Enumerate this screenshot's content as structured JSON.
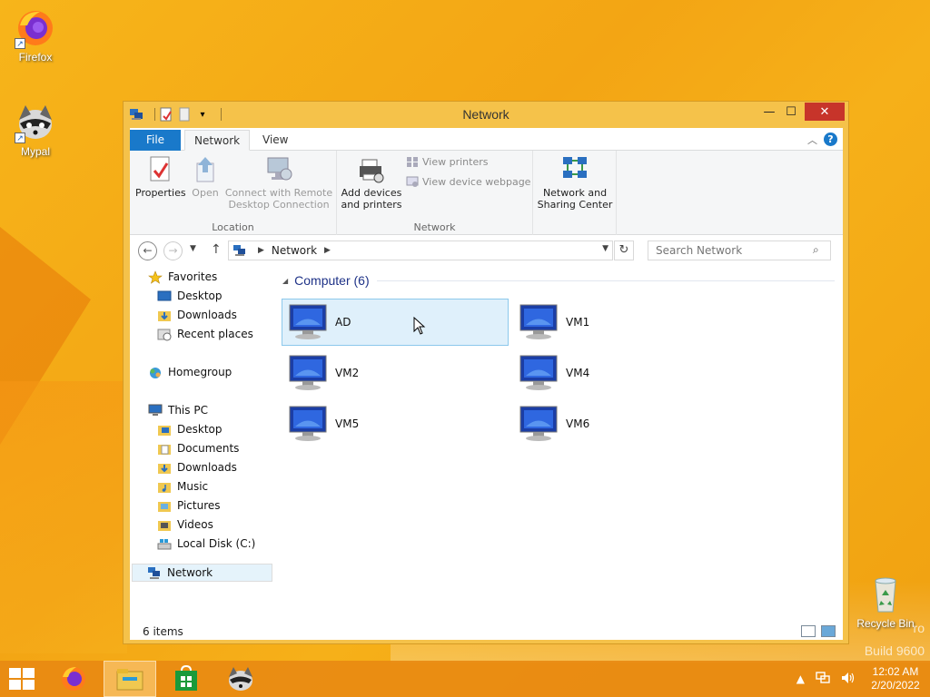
{
  "desktop": {
    "icons": [
      {
        "label": "Firefox"
      },
      {
        "label": "Mypal"
      },
      {
        "label": "Recycle Bin"
      }
    ],
    "watermark": {
      "line1": "ro",
      "line2": "Build 9600"
    }
  },
  "window": {
    "title": "Network",
    "controls": {
      "minimize": "—",
      "maximize": "☐",
      "close": "✕"
    },
    "tabs": {
      "file": "File",
      "network": "Network",
      "view": "View"
    },
    "ribbon": {
      "location_group": "Location",
      "network_group": "Network",
      "properties": "Properties",
      "open": "Open",
      "connect_line1": "Connect with Remote",
      "connect_line2": "Desktop Connection",
      "add_devices_line1": "Add devices",
      "add_devices_line2": "and printers",
      "view_printers": "View printers",
      "view_device_webpage": "View device webpage",
      "sharing_line1": "Network and",
      "sharing_line2": "Sharing Center"
    },
    "address": {
      "crumb": "Network"
    },
    "search": {
      "placeholder": "Search Network"
    },
    "nav": {
      "favorites": "Favorites",
      "fav_desktop": "Desktop",
      "fav_downloads": "Downloads",
      "fav_recent": "Recent places",
      "homegroup": "Homegroup",
      "thispc": "This PC",
      "pc_desktop": "Desktop",
      "pc_documents": "Documents",
      "pc_downloads": "Downloads",
      "pc_music": "Music",
      "pc_pictures": "Pictures",
      "pc_videos": "Videos",
      "pc_localdisk": "Local Disk (C:)",
      "network": "Network"
    },
    "content": {
      "group_title": "Computer (6)",
      "computers": [
        "AD",
        "VM1",
        "VM2",
        "VM4",
        "VM5",
        "VM6"
      ]
    },
    "status": {
      "items": "6 items"
    }
  },
  "taskbar": {
    "time": "12:02 AM",
    "date": "2/20/2022"
  },
  "colors": {
    "accent": "#1979ca",
    "window_frame": "#f5c24a",
    "close": "#c7342a",
    "desktop": "#f3a514",
    "selection": "#dff0fb"
  }
}
